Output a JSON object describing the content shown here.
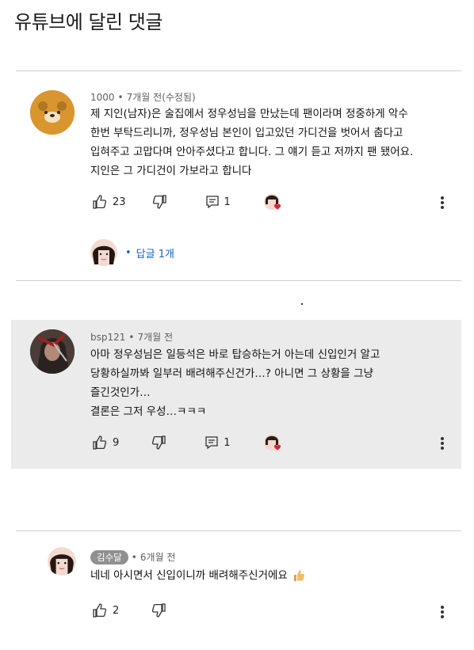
{
  "page": {
    "title": "유튜브에 달린 댓글"
  },
  "comments": [
    {
      "author": "1000",
      "time": "7개월 전(수정됨)",
      "lines": [
        "제 지인(남자)은 술집에서 정우성님을 만났는데 팬이라며 정중하게 악수",
        "한번 부탁드리니까, 정우성님 본인이 입고있던 가디건을 벗어서 춥다고",
        "입혀주고 고맙다며 안아주셨다고 합니다. 그 얘기 듣고 저까지 팬 됐어요.",
        "지인은 그 가디건이 가보라고 합니다"
      ],
      "likes": "23",
      "replies": "1",
      "reply_link": "답글 1개"
    },
    {
      "author": "bsp121",
      "time": "7개월 전",
      "lines": [
        "아마 정우성님은 일등석은 바로 탑승하는거 아는데 신입인거 알고",
        "당황하실까봐 일부러 배려해주신건가…? 아니면 그 상황을 그냥",
        "즐긴것인가…",
        "결론은 그저 우성…ㅋㅋㅋ"
      ],
      "likes": "9",
      "replies": "1"
    },
    {
      "author": "김수달",
      "time": "6개월 전",
      "lines": [
        "네네 아시면서 신입이니까 배려해주신거에요"
      ],
      "likes": "2"
    }
  ],
  "colors": {
    "highlight_bg": "#ebebeb",
    "reply_link": "#1a5fd0",
    "heart": "#e0202a",
    "author_badge": "#909090"
  },
  "icons": [
    "like-icon",
    "dislike-icon",
    "reply-icon",
    "more-icon",
    "heart-icon",
    "thumbs-up-emoji"
  ]
}
